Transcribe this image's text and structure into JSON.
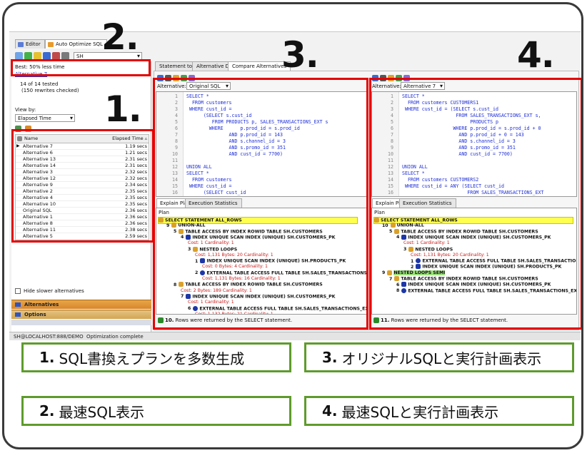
{
  "editor_tabs": [
    "Editor",
    "Auto Optimize SQL"
  ],
  "schema_box": "SH",
  "left_panel": {
    "best_label": "Best: 50% less time",
    "best_link": "Alternative 7",
    "tested": "14 of 14 tested",
    "rewrites": "(150 rewrites checked)",
    "view_by_label": "View by:",
    "view_by_value": "Elapsed Time",
    "table_headers": [
      "Name",
      "Elapsed Time"
    ],
    "rows": [
      {
        "name": "Alternative 7",
        "time": "1.19 secs"
      },
      {
        "name": "Alternative 6",
        "time": "1.21 secs"
      },
      {
        "name": "Alternative 13",
        "time": "2.31 secs"
      },
      {
        "name": "Alternative 14",
        "time": "2.31 secs"
      },
      {
        "name": "Alternative 3",
        "time": "2.32 secs"
      },
      {
        "name": "Alternative 12",
        "time": "2.32 secs"
      },
      {
        "name": "Alternative 9",
        "time": "2.34 secs"
      },
      {
        "name": "Alternative 2",
        "time": "2.35 secs"
      },
      {
        "name": "Alternative 4",
        "time": "2.35 secs"
      },
      {
        "name": "Alternative 10",
        "time": "2.35 secs"
      },
      {
        "name": "Original SQL",
        "time": "2.36 secs"
      },
      {
        "name": "Alternative 1",
        "time": "2.36 secs"
      },
      {
        "name": "Alternative 8",
        "time": "2.36 secs"
      },
      {
        "name": "Alternative 11",
        "time": "2.38 secs"
      },
      {
        "name": "Alternative 5",
        "time": "2.59 secs"
      }
    ],
    "hide_slower": "Hide slower alternatives",
    "panel_alternatives": "Alternatives",
    "panel_options": "Options",
    "status_conn": "SH@LOCALHOST:888/DEMO",
    "status_msg": "Optimization complete"
  },
  "right_tabs": [
    "Statement to Tune",
    "Alternative Detail",
    "Compare Alternatives"
  ],
  "middle": {
    "alt_label": "Alternative:",
    "alt_value": "Original SQL",
    "lines": [
      {
        "n": "1",
        "t": "SELECT *"
      },
      {
        "n": "2",
        "t": "  FROM customers"
      },
      {
        "n": "3",
        "t": " WHERE cust_id ="
      },
      {
        "n": "4",
        "t": "      (SELECT s.cust_id"
      },
      {
        "n": "5",
        "t": "         FROM PRODUCTS p, SALES_TRANSACTIONS_EXT s"
      },
      {
        "n": "6",
        "t": "        WHERE      p.prod_id = s.prod_id"
      },
      {
        "n": "7",
        "t": "               AND p.prod_id = 143"
      },
      {
        "n": "8",
        "t": "               AND s.channel_id = 3"
      },
      {
        "n": "9",
        "t": "               AND s.promo_id = 351"
      },
      {
        "n": "10",
        "t": "               AND cust_id = 7700)"
      },
      {
        "n": "11",
        "t": ""
      },
      {
        "n": "12",
        "t": "UNION ALL"
      },
      {
        "n": "13",
        "t": "SELECT *"
      },
      {
        "n": "14",
        "t": "  FROM customers"
      },
      {
        "n": "15",
        "t": " WHERE cust_id ="
      },
      {
        "n": "16",
        "t": "      (SELECT cust_id"
      }
    ],
    "plan_tabs": [
      "Explain Plan",
      "Execution Statistics"
    ],
    "plan_header": "Plan",
    "plan": [
      {
        "n": "",
        "t": "SELECT STATEMENT  ALL_ROWS",
        "b": true,
        "y": true,
        "i": 0
      },
      {
        "n": "9",
        "t": "UNION-ALL",
        "b": true,
        "i": 1
      },
      {
        "n": "5",
        "t": "TABLE ACCESS BY INDEX ROWID TABLE SH.CUSTOMERS",
        "b": true,
        "i": 2
      },
      {
        "n": "4",
        "t": "INDEX UNIQUE SCAN INDEX (UNIQUE) SH.CUSTOMERS_PK",
        "b": true,
        "i": 3
      },
      {
        "n": "",
        "t": "Cost: 1  Cardinality: 1",
        "c": true,
        "i": 4
      },
      {
        "n": "3",
        "t": "NESTED LOOPS",
        "b": true,
        "i": 4
      },
      {
        "n": "",
        "t": "Cost: 1,131  Bytes: 20  Cardinality: 1",
        "c": true,
        "i": 5
      },
      {
        "n": "1",
        "t": "INDEX UNIQUE SCAN INDEX (UNIQUE) SH.PRODUCTS_PK",
        "b": true,
        "i": 5
      },
      {
        "n": "",
        "t": "Cost: 0  Bytes: 4  Cardinality: 1",
        "c": true,
        "i": 6
      },
      {
        "n": "2",
        "t": "EXTERNAL TABLE ACCESS FULL TABLE SH.SALES_TRANSACTIONS_EXT",
        "b": true,
        "i": 5
      },
      {
        "n": "",
        "t": "Cost: 1,131  Bytes: 16  Cardinality: 1",
        "c": true,
        "i": 6
      },
      {
        "n": "8",
        "t": "TABLE ACCESS BY INDEX ROWID TABLE SH.CUSTOMERS",
        "b": true,
        "i": 2
      },
      {
        "n": "",
        "t": "Cost: 2  Bytes: 189  Cardinality: 1",
        "c": true,
        "i": 3
      },
      {
        "n": "7",
        "t": "INDEX UNIQUE SCAN INDEX (UNIQUE) SH.CUSTOMERS_PK",
        "b": true,
        "i": 3
      },
      {
        "n": "",
        "t": "Cost: 1  Cardinality: 1",
        "c": true,
        "i": 4
      },
      {
        "n": "6",
        "t": "EXTERNAL TABLE ACCESS FULL TABLE SH.SALES_TRANSACTIONS_EXT",
        "b": true,
        "i": 4
      },
      {
        "n": "",
        "t": "Cost: 1,132  Bytes: 21  Cardinality: 1",
        "c": true,
        "i": 5
      }
    ],
    "footer": "Rows were returned by the SELECT statement.",
    "footer_num": "10."
  },
  "right": {
    "alt_label": "Alternative:",
    "alt_value": "Alternative 7",
    "lines": [
      {
        "n": "1",
        "t": "SELECT *"
      },
      {
        "n": "2",
        "t": "  FROM customers CUSTOMERS1"
      },
      {
        "n": "3",
        "t": " WHERE cust_id = (SELECT s.cust_id"
      },
      {
        "n": "4",
        "t": "                   FROM SALES_TRANSACTIONS_EXT s,"
      },
      {
        "n": "5",
        "t": "                        PRODUCTS p"
      },
      {
        "n": "6",
        "t": "                  WHERE p.prod_id = s.prod_id + 0"
      },
      {
        "n": "7",
        "t": "                    AND p.prod_id + 0 = 143"
      },
      {
        "n": "8",
        "t": "                    AND s.channel_id = 3"
      },
      {
        "n": "9",
        "t": "                    AND s.promo_id = 351"
      },
      {
        "n": "10",
        "t": "                    AND cust_id = 7700)"
      },
      {
        "n": "11",
        "t": ""
      },
      {
        "n": "12",
        "t": "UNION ALL"
      },
      {
        "n": "13",
        "t": "SELECT *"
      },
      {
        "n": "14",
        "t": "  FROM customers CUSTOMERS2"
      },
      {
        "n": "15",
        "t": " WHERE cust_id = ANY (SELECT cust_id"
      },
      {
        "n": "16",
        "t": "                       FROM SALES_TRANSACTIONS_EXT"
      }
    ],
    "plan_tabs": [
      "Explain Plan",
      "Execution Statistics"
    ],
    "plan_header": "Plan",
    "plan": [
      {
        "n": "",
        "t": "SELECT STATEMENT  ALL_ROWS",
        "b": true,
        "y": true,
        "i": 0
      },
      {
        "n": "10",
        "t": "UNION-ALL",
        "b": true,
        "i": 1
      },
      {
        "n": "5",
        "t": "TABLE ACCESS BY INDEX ROWID TABLE SH.CUSTOMERS",
        "b": true,
        "i": 2
      },
      {
        "n": "4",
        "t": "INDEX UNIQUE SCAN INDEX (UNIQUE) SH.CUSTOMERS_PK",
        "b": true,
        "i": 3
      },
      {
        "n": "",
        "t": "Cost: 1  Cardinality: 1",
        "c": true,
        "i": 4
      },
      {
        "n": "3",
        "t": "NESTED LOOPS",
        "b": true,
        "i": 4
      },
      {
        "n": "",
        "t": "Cost: 1,131  Bytes: 20  Cardinality: 1",
        "c": true,
        "i": 5
      },
      {
        "n": "1",
        "t": "EXTERNAL TABLE ACCESS FULL TABLE SH.SALES_TRANSACTIONS_EXT",
        "b": true,
        "i": 5
      },
      {
        "n": "2",
        "t": "INDEX UNIQUE SCAN INDEX (UNIQUE) SH.PRODUCTS_PK",
        "b": true,
        "i": 5
      },
      {
        "n": "9",
        "t": "NESTED LOOPS SEMI",
        "b": true,
        "g": true,
        "i": 1
      },
      {
        "n": "7",
        "t": "TABLE ACCESS BY INDEX ROWID TABLE SH.CUSTOMERS",
        "b": true,
        "i": 2
      },
      {
        "n": "6",
        "t": "INDEX UNIQUE SCAN INDEX (UNIQUE) SH.CUSTOMERS_PK",
        "b": true,
        "i": 3
      },
      {
        "n": "8",
        "t": "EXTERNAL TABLE ACCESS FULL TABLE SH.SALES_TRANSACTIONS_EXT",
        "b": true,
        "i": 3
      }
    ],
    "footer": "Rows were returned by the SELECT statement.",
    "footer_num": "11."
  },
  "big_numbers": [
    "2.",
    "3.",
    "4.",
    "1."
  ],
  "captions": [
    {
      "num": "1.",
      "text": "SQL書換えプランを多数生成"
    },
    {
      "num": "3.",
      "text": "オリジナルSQLと実行計画表示"
    },
    {
      "num": "2.",
      "text": "最速SQL表示"
    },
    {
      "num": "4.",
      "text": "最速SQLと実行計画表示"
    }
  ],
  "colors": {
    "highlight": "#e30000",
    "caption_border": "#5e9b2c",
    "keyword": "#1e2fd6",
    "string": "#e0332a"
  }
}
